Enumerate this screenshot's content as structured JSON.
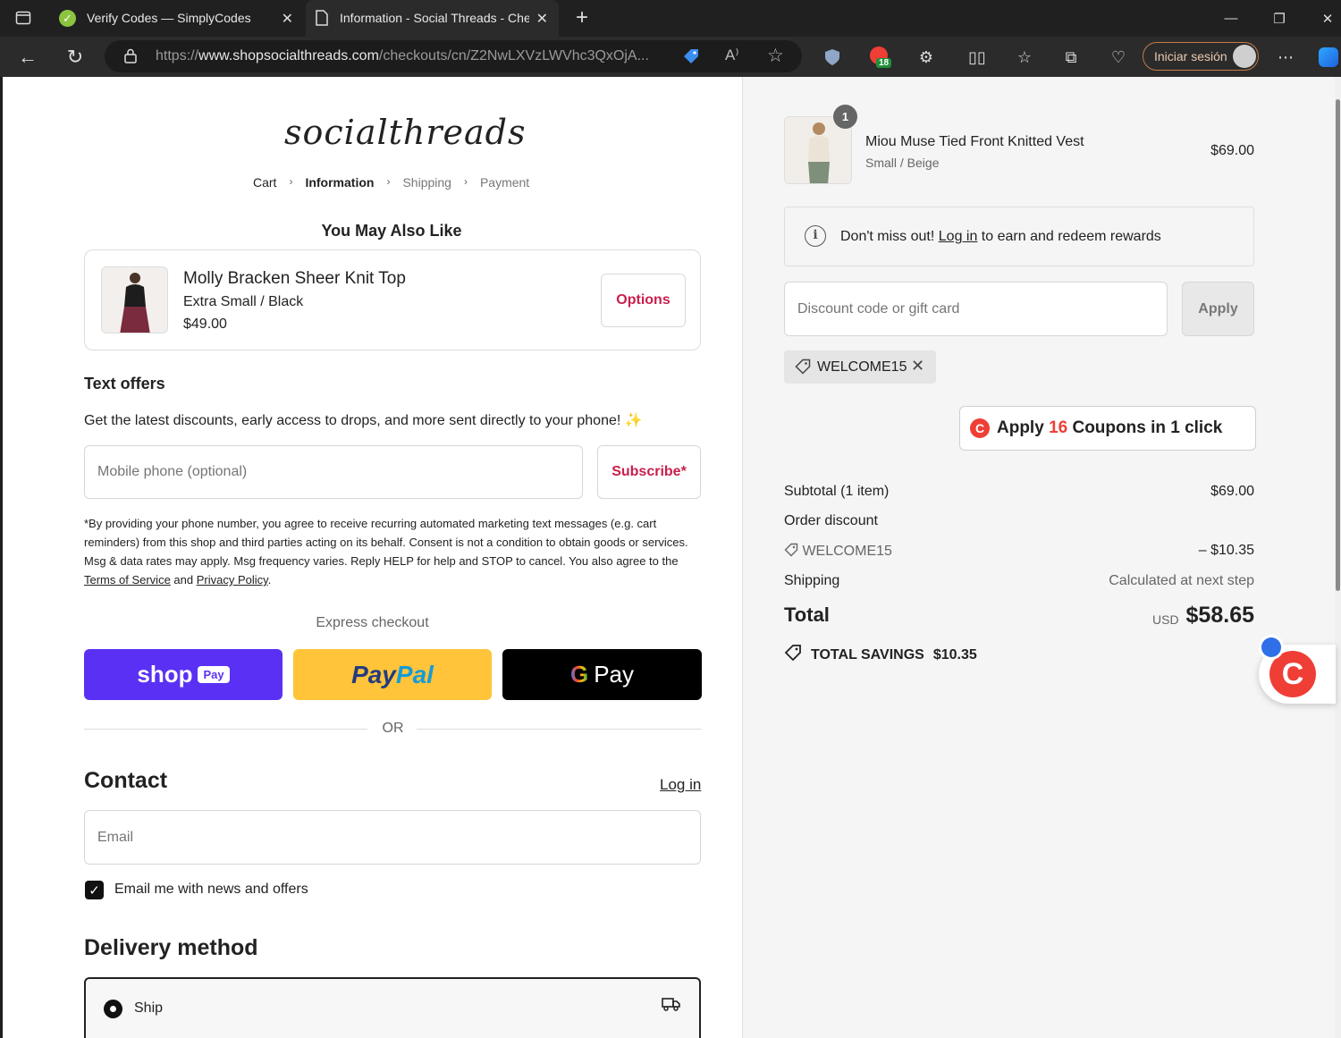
{
  "browser": {
    "tabs": [
      {
        "title": "Verify Codes — SimplyCodes",
        "active": false
      },
      {
        "title": "Information - Social Threads - Che",
        "active": true
      }
    ],
    "url_prefix": "https://",
    "url_domain": "www.shopsocialthreads.com",
    "url_path": "/checkouts/cn/Z2NwLXVzLWVhc3QxOjA...",
    "signin_label": "Iniciar sesión",
    "ext_badge": "18"
  },
  "store": {
    "logo": "socialthreads",
    "breadcrumbs": [
      "Cart",
      "Information",
      "Shipping",
      "Payment"
    ]
  },
  "recommend": {
    "title": "You May Also Like",
    "name": "Molly Bracken Sheer Knit Top",
    "variant": "Extra Small / Black",
    "price": "$49.00",
    "options_label": "Options"
  },
  "text_offers": {
    "heading": "Text offers",
    "desc": "Get the latest discounts, early access to drops, and more sent directly to your phone! ✨",
    "phone_placeholder": "Mobile phone (optional)",
    "subscribe_label": "Subscribe*",
    "legal_1": "*By providing your phone number, you agree to receive recurring automated marketing text messages (e.g. cart reminders) from this shop and third parties acting on its behalf. Consent is not a condition to obtain goods or services. Msg & data rates may apply. Msg frequency varies. Reply HELP for help and STOP to cancel. You also agree to the ",
    "terms": "Terms of Service",
    "and": " and ",
    "privacy": "Privacy Policy",
    "end": "."
  },
  "express": {
    "label": "Express checkout",
    "shop": "shop",
    "shop_pill": "Pay",
    "paypal_1": "Pay",
    "paypal_2": "Pal",
    "gpay_g": "G",
    "gpay_text": "Pay",
    "or": "OR"
  },
  "contact": {
    "heading": "Contact",
    "login": "Log in",
    "email_placeholder": "Email",
    "news_label": "Email me with news and offers",
    "news_checked": true
  },
  "delivery": {
    "heading": "Delivery method",
    "option": "Ship"
  },
  "cart": {
    "qty": "1",
    "name": "Miou Muse Tied Front Knitted Vest",
    "variant": "Small / Beige",
    "price": "$69.00"
  },
  "rewards": {
    "pre": "Don't miss out! ",
    "link": "Log in",
    "post": " to earn and redeem rewards"
  },
  "discount": {
    "placeholder": "Discount code or gift card",
    "apply_label": "Apply",
    "code": "WELCOME15"
  },
  "coupons": {
    "pre": "Apply ",
    "count": "16",
    "post": " Coupons in 1 click"
  },
  "summary": {
    "subtotal_label": "Subtotal (1 item)",
    "subtotal": "$69.00",
    "order_discount_label": "Order discount",
    "discount_code": "WELCOME15",
    "discount_value": "– $10.35",
    "shipping_label": "Shipping",
    "shipping_value": "Calculated at next step",
    "total_label": "Total",
    "currency": "USD",
    "total": "$58.65",
    "savings_label": "TOTAL SAVINGS",
    "savings_value": "$10.35"
  },
  "colors": {
    "accent": "#c91f4b",
    "shop_pay": "#5a31f4",
    "paypal": "#ffc439",
    "coupon_red": "#ef3e36"
  }
}
